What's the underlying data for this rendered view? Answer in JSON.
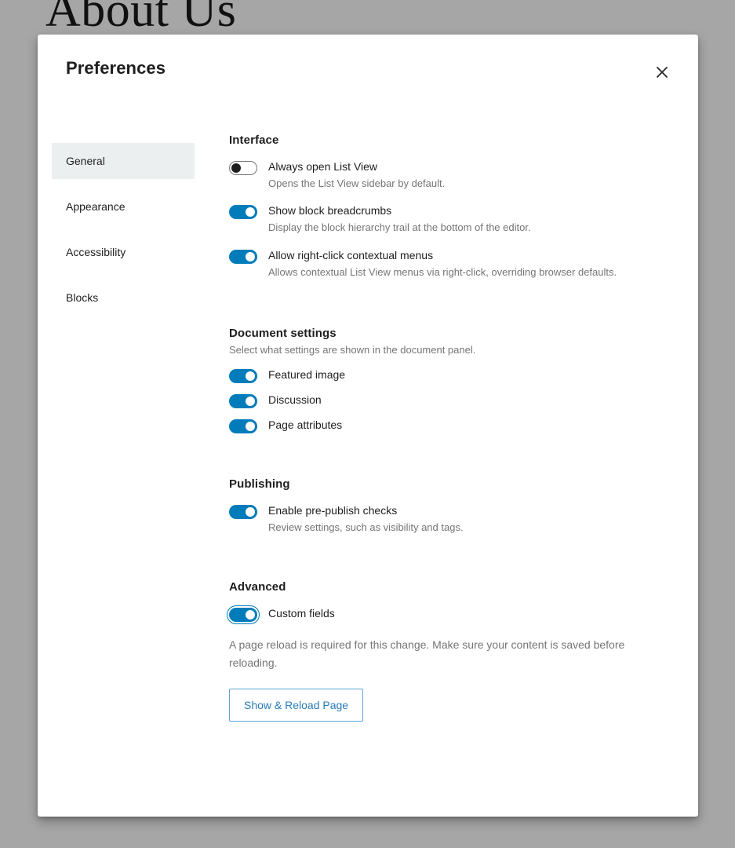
{
  "backdrop": {
    "page_title": "About Us"
  },
  "modal": {
    "title": "Preferences",
    "close_icon": "close-icon"
  },
  "sidebar": {
    "items": [
      {
        "label": "General",
        "selected": true
      },
      {
        "label": "Appearance",
        "selected": false
      },
      {
        "label": "Accessibility",
        "selected": false
      },
      {
        "label": "Blocks",
        "selected": false
      }
    ]
  },
  "sections": {
    "interface": {
      "title": "Interface",
      "toggles": [
        {
          "label": "Always open List View",
          "help": "Opens the List View sidebar by default.",
          "state": "off",
          "focused": false
        },
        {
          "label": "Show block breadcrumbs",
          "help": "Display the block hierarchy trail at the bottom of the editor.",
          "state": "on",
          "focused": false
        },
        {
          "label": "Allow right-click contextual menus",
          "help": "Allows contextual List View menus via right-click, overriding browser defaults.",
          "state": "on",
          "focused": false
        }
      ]
    },
    "document_settings": {
      "title": "Document settings",
      "description": "Select what settings are shown in the document panel.",
      "toggles": [
        {
          "label": "Featured image",
          "help": "",
          "state": "on",
          "focused": false
        },
        {
          "label": "Discussion",
          "help": "",
          "state": "on",
          "focused": false
        },
        {
          "label": "Page attributes",
          "help": "",
          "state": "on",
          "focused": false
        }
      ]
    },
    "publishing": {
      "title": "Publishing",
      "toggles": [
        {
          "label": "Enable pre-publish checks",
          "help": "Review settings, such as visibility and tags.",
          "state": "on",
          "focused": false
        }
      ]
    },
    "advanced": {
      "title": "Advanced",
      "toggles": [
        {
          "label": "Custom fields",
          "help": "",
          "state": "on",
          "focused": true
        }
      ],
      "reload_note": "A page reload is required for this change. Make sure your content is saved before reloading.",
      "reload_button_label": "Show & Reload Page"
    }
  },
  "colors": {
    "accent_blue": "#007cba",
    "button_blue_text": "#2a7bb9",
    "button_blue_border": "#5ba7d8",
    "text_primary": "#1e1e1e",
    "text_muted": "#757575",
    "selected_nav_bg": "#eceff0",
    "overlay_gray": "#a6a6a6"
  }
}
